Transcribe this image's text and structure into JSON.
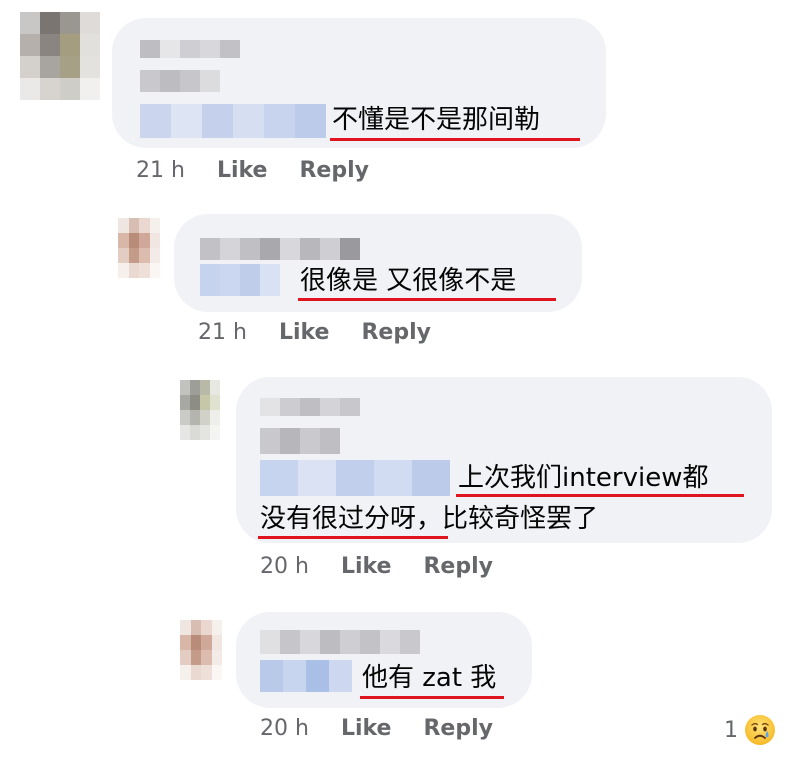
{
  "comments": [
    {
      "id": "c1",
      "text": "不懂是不是那间勒",
      "time": "21 h",
      "like_label": "Like",
      "reply_label": "Reply"
    },
    {
      "id": "c2",
      "text": "很像是 又很像不是",
      "time": "21 h",
      "like_label": "Like",
      "reply_label": "Reply"
    },
    {
      "id": "c3",
      "text_line1": "上次我们interview都",
      "text_line2": "没有很过分呀，比较奇怪罢了",
      "time": "20 h",
      "like_label": "Like",
      "reply_label": "Reply"
    },
    {
      "id": "c4",
      "text": "他有 zat 我",
      "time": "20 h",
      "like_label": "Like",
      "reply_label": "Reply",
      "reaction_count": "1",
      "reaction_icon": "sad-cry-emoji-icon"
    }
  ],
  "colors": {
    "bubble": "#f0f2f5",
    "underline": "#e0141e",
    "meta_text": "#65676b",
    "body_text": "#050505",
    "redacted_name": "#c8c8cc",
    "redacted_highlight": "#c9d6ef"
  }
}
